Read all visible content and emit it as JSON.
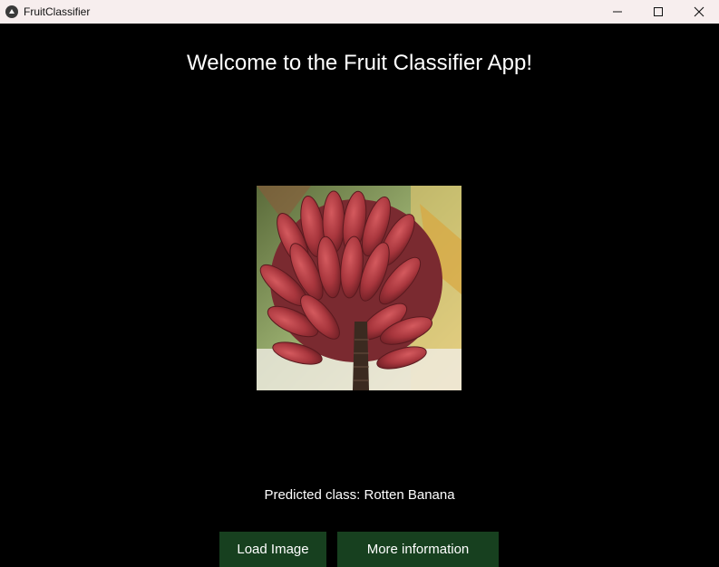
{
  "window": {
    "title": "FruitClassifier",
    "controls": [
      "minimize-icon",
      "maximize-icon",
      "close-icon"
    ]
  },
  "main": {
    "welcome_text": "Welcome to the Fruit Classifier App!",
    "prediction_text": "Predicted class: Rotten Banana",
    "buttons": {
      "load_image": "Load Image",
      "more_info": "More information"
    }
  },
  "colors": {
    "background": "#000000",
    "button": "#17401f",
    "titlebar": "#f7eeee",
    "text": "#ffffff"
  }
}
